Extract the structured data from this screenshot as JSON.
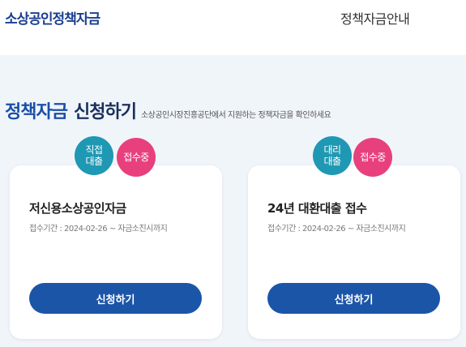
{
  "header": {
    "logo": "소상공인정책자금",
    "nav_item": "정책자금안내"
  },
  "section": {
    "title_highlight": "정책자금",
    "title_rest": "신청하기",
    "subtitle": "소상공인시장진흥공단에서 지원하는 정책자금을 확인하세요"
  },
  "cards": [
    {
      "type_badge": "직접 대출",
      "status_badge": "접수중",
      "title": "저신용소상공인자금",
      "period": "접수기간 : 2024-02-26 ~ 자금소진시까지",
      "button": "신청하기"
    },
    {
      "type_badge": "대리 대출",
      "status_badge": "접수중",
      "title": "24년 대환대출 접수",
      "period": "접수기간 : 2024-02-26 ~ 자금소진시까지",
      "button": "신청하기"
    }
  ],
  "colors": {
    "primary": "#1b55a8",
    "type_badge": "#1f98b4",
    "status_badge": "#e8407c",
    "background": "#f0f5fa"
  }
}
